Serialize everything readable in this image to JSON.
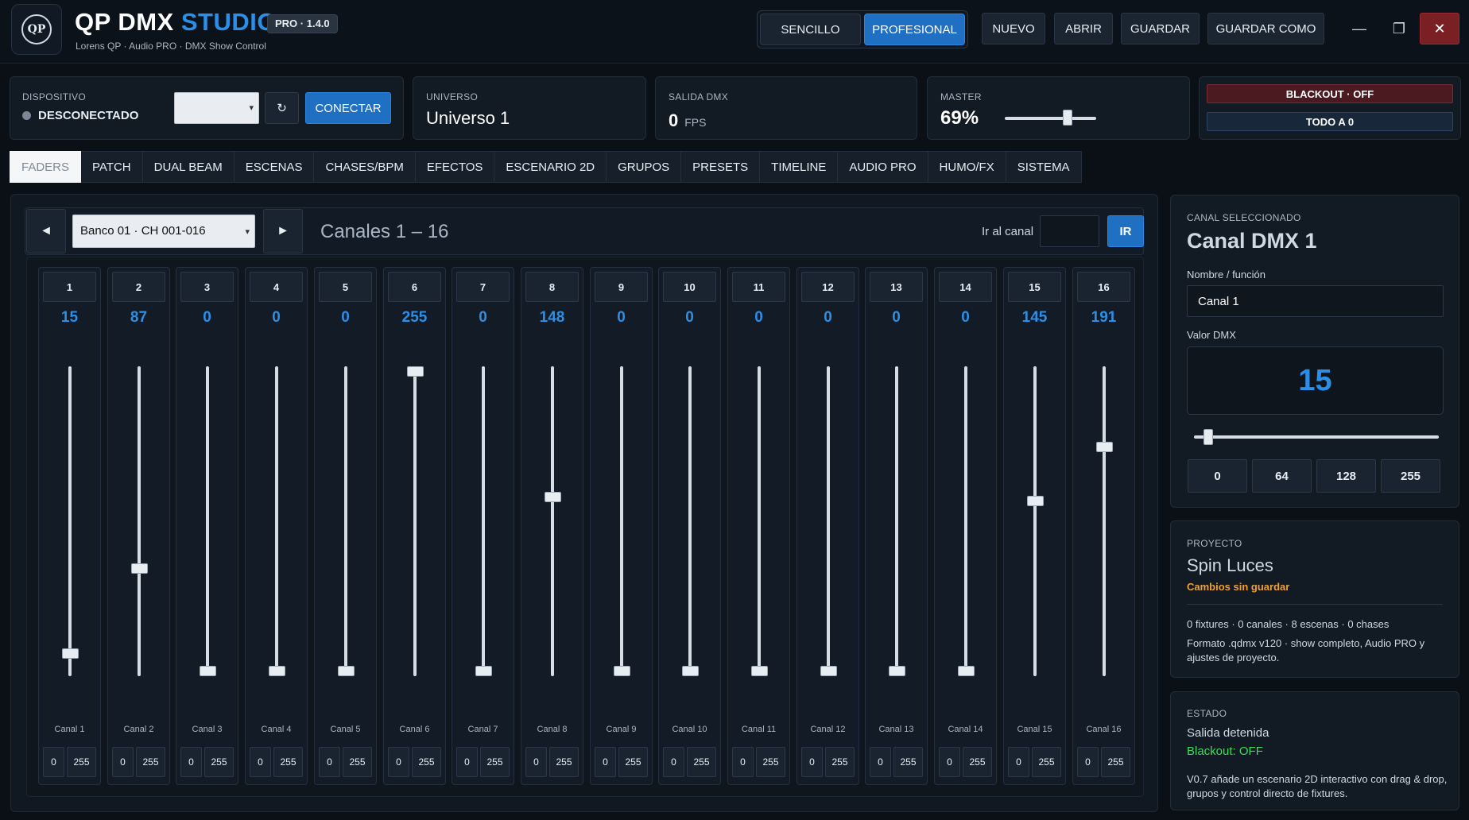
{
  "app": {
    "title_main": "QP DMX",
    "title_accent": "STUDIO",
    "version": "PRO · 1.4.0",
    "subtitle": "Lorens QP · Audio PRO · DMX Show Control",
    "logo_text": "QP"
  },
  "mode": {
    "simple_label": "SENCILLO",
    "pro_label": "PROFESIONAL",
    "active": "PROFESIONAL"
  },
  "toolbar": {
    "new_label": "NUEVO",
    "open_label": "ABRIR",
    "save_label": "GUARDAR",
    "save_as_label": "GUARDAR COMO"
  },
  "window": {
    "minimize": "—",
    "maximize": "❐",
    "close": "✕"
  },
  "device": {
    "label": "DISPOSITIVO",
    "status": "DESCONECTADO",
    "selected": "",
    "refresh_icon": "↻",
    "connect_label": "CONECTAR"
  },
  "universe": {
    "label": "UNIVERSO",
    "value": "Universo 1"
  },
  "dmx_output": {
    "label": "SALIDA DMX",
    "value": "0",
    "unit": "FPS"
  },
  "master": {
    "label": "MASTER",
    "value_text": "69%",
    "level": 0.69
  },
  "blackout": {
    "blackout_label": "BLACKOUT · OFF",
    "all_zero_label": "TODO A 0"
  },
  "tabs": [
    "FADERS",
    "PATCH",
    "DUAL BEAM",
    "ESCENAS",
    "CHASES/BPM",
    "EFECTOS",
    "ESCENARIO 2D",
    "GRUPOS",
    "PRESETS",
    "TIMELINE",
    "AUDIO PRO",
    "HUMO/FX",
    "SISTEMA"
  ],
  "active_tab": "FADERS",
  "bank": {
    "prev_icon": "◄",
    "next_icon": "►",
    "selected": "Banco 01  ·  CH 001-016",
    "title": "Canales 1 – 16",
    "goto_label": "Ir al canal",
    "goto_value": "",
    "goto_button": "IR"
  },
  "channels": [
    {
      "num": "1",
      "value": 15,
      "name": "Canal 1"
    },
    {
      "num": "2",
      "value": 87,
      "name": "Canal 2"
    },
    {
      "num": "3",
      "value": 0,
      "name": "Canal 3"
    },
    {
      "num": "4",
      "value": 0,
      "name": "Canal 4"
    },
    {
      "num": "5",
      "value": 0,
      "name": "Canal 5"
    },
    {
      "num": "6",
      "value": 255,
      "name": "Canal 6"
    },
    {
      "num": "7",
      "value": 0,
      "name": "Canal 7"
    },
    {
      "num": "8",
      "value": 148,
      "name": "Canal 8"
    },
    {
      "num": "9",
      "value": 0,
      "name": "Canal 9"
    },
    {
      "num": "10",
      "value": 0,
      "name": "Canal 10"
    },
    {
      "num": "11",
      "value": 0,
      "name": "Canal 11"
    },
    {
      "num": "12",
      "value": 0,
      "name": "Canal 12"
    },
    {
      "num": "13",
      "value": 0,
      "name": "Canal 13"
    },
    {
      "num": "14",
      "value": 0,
      "name": "Canal 14"
    },
    {
      "num": "15",
      "value": 145,
      "name": "Canal 15"
    },
    {
      "num": "16",
      "value": 191,
      "name": "Canal 16"
    }
  ],
  "mini_labels": {
    "min": "0",
    "max": "255"
  },
  "selected_channel": {
    "label": "CANAL SELECCIONADO",
    "title": "Canal DMX 1",
    "name_label": "Nombre / función",
    "name_value": "Canal 1",
    "value_label": "Valor DMX",
    "value": "15",
    "level": 15,
    "quick": [
      "0",
      "64",
      "128",
      "255"
    ]
  },
  "project": {
    "label": "PROYECTO",
    "name": "Spin Luces",
    "status": "Cambios sin guardar",
    "stats": "0 fixtures · 0 canales · 8 escenas · 0 chases",
    "format": "Formato .qdmx v120 · show completo, Audio PRO y ajustes de proyecto."
  },
  "state": {
    "label": "ESTADO",
    "output": "Salida detenida",
    "blackout": "Blackout: OFF",
    "note": "V0.7 añade un escenario 2D interactivo con drag & drop, grupos y control directo de fixtures."
  },
  "colors": {
    "accent": "#2b8fe8",
    "warning": "#f0a030",
    "ok": "#3ddc5a",
    "blackout_bg": "#4a1a20"
  }
}
